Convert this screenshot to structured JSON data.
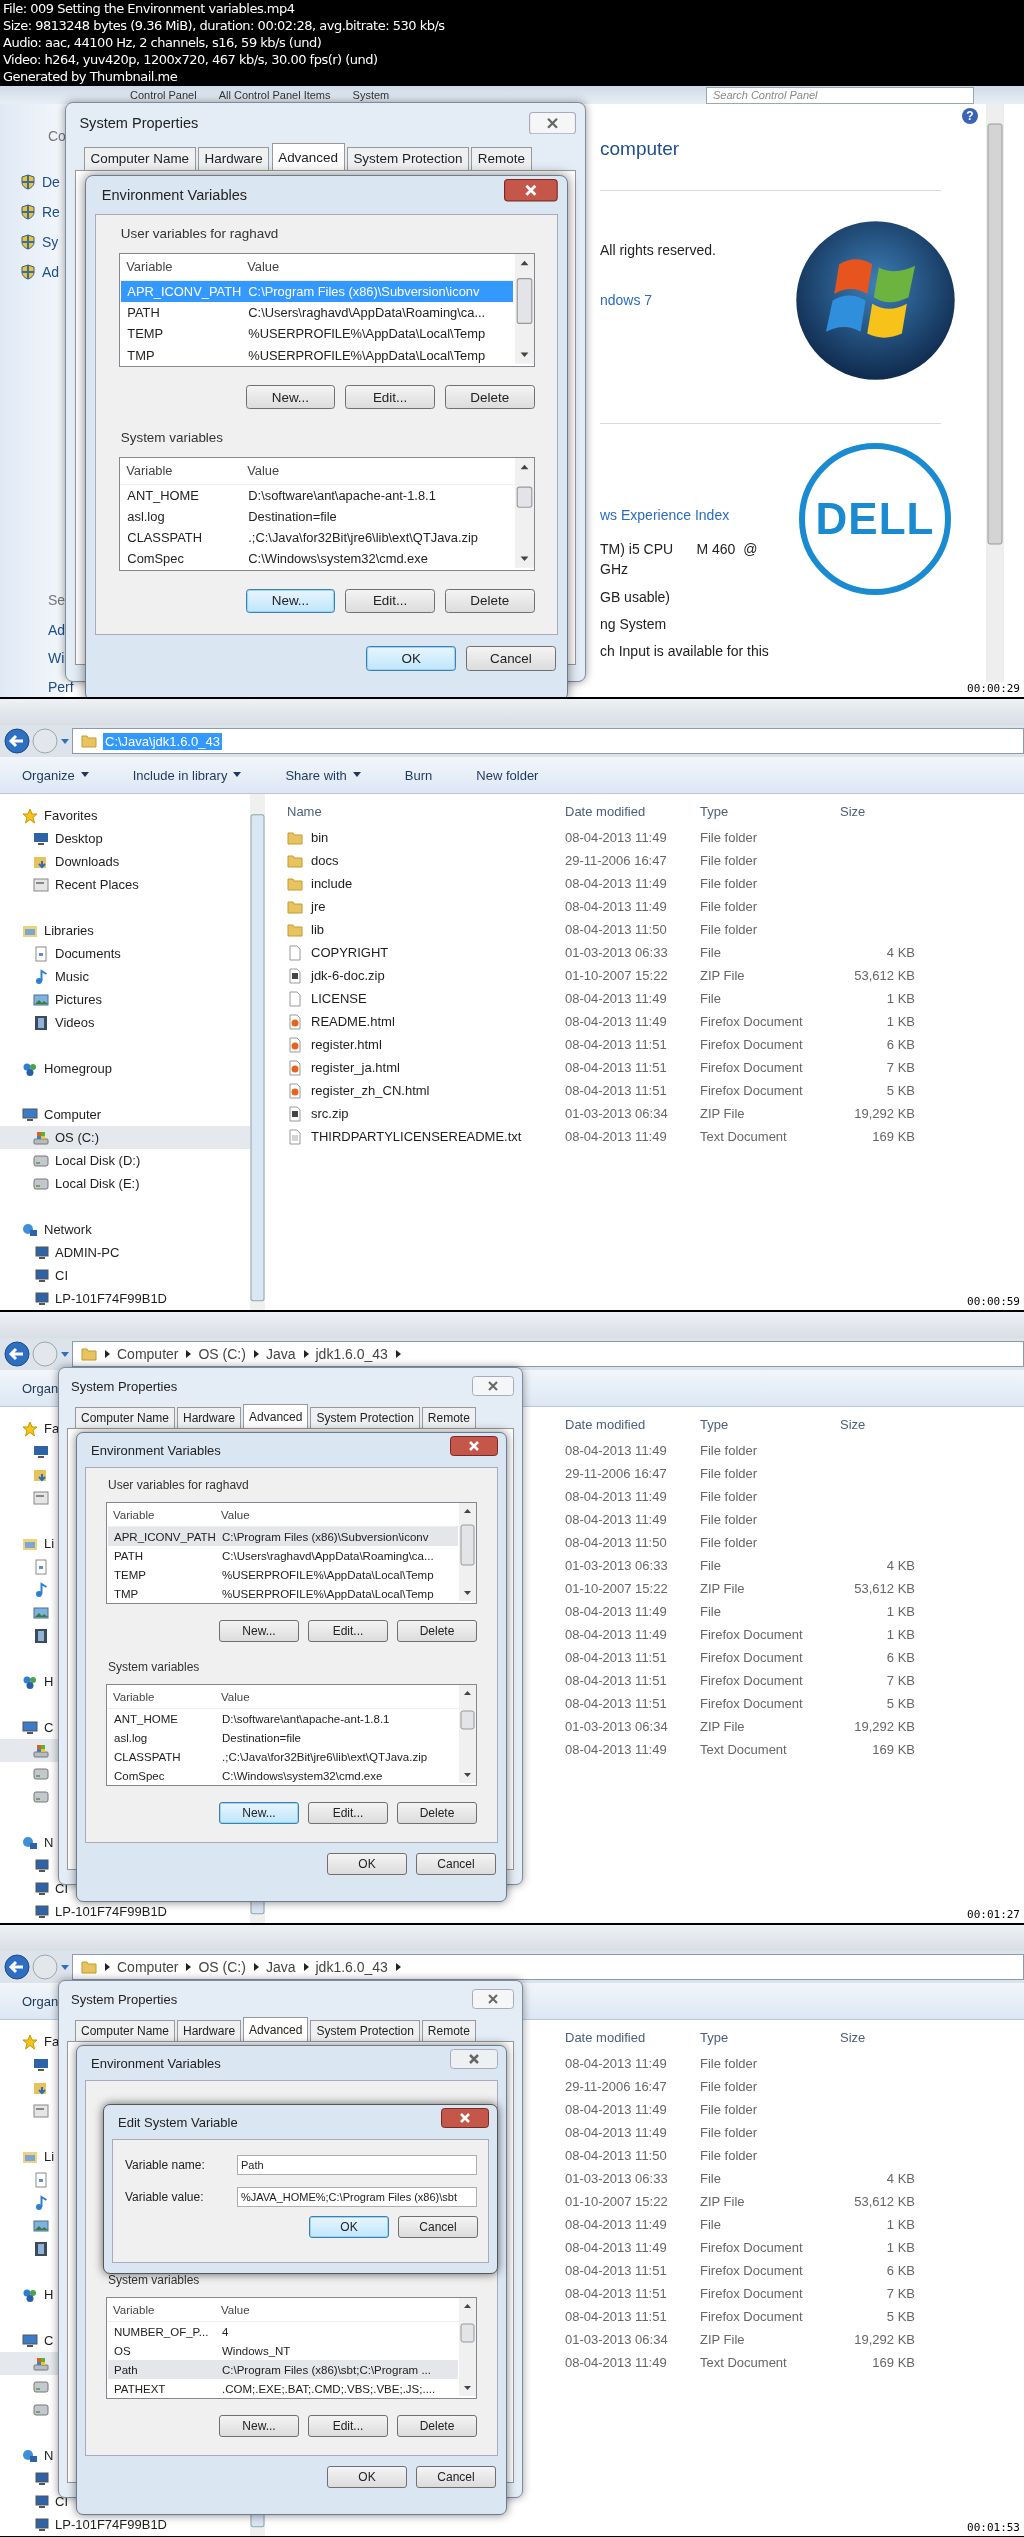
{
  "header": [
    "File: 009 Setting the Environment variables.mp4",
    "Size: 9813248 bytes (9.36 MiB), duration: 00:02:28, avg.bitrate: 530 kb/s",
    "Audio: aac, 44100 Hz, 2 channels, s16, 59 kb/s (und)",
    "Video: h264, yuv420p, 1200x720, 467 kb/s, 30.00 fps(r) (und)",
    "Generated by Thumbnail.me"
  ],
  "frames": [
    {
      "kind": "control_panel",
      "timestamp": "00:00:29",
      "breadcrumb": [
        "Control Panel",
        "All Control Panel Items",
        "System"
      ],
      "search": {
        "placeholder": "Search Control Panel"
      },
      "help_icon": "?",
      "nav": [
        {
          "label": "Co",
          "kind": "heading"
        },
        {
          "label": "De",
          "kind": "shield"
        },
        {
          "label": "Re",
          "kind": "shield"
        },
        {
          "label": "Sy",
          "kind": "shield"
        },
        {
          "label": "Ad",
          "kind": "shield"
        },
        {
          "label": "Se",
          "kind": "heading"
        },
        {
          "label": "Ad",
          "kind": "link"
        },
        {
          "label": "Wi",
          "kind": "link"
        },
        {
          "label": "Perf",
          "kind": "link"
        }
      ],
      "content": [
        {
          "text": "computer",
          "kind": "heading"
        },
        {
          "text": "All rights reserved.",
          "kind": "text"
        },
        {
          "text": "ndows 7",
          "kind": "link"
        },
        {
          "text": "ws Experience Index",
          "kind": "link"
        },
        {
          "text": "TM) i5 CPU      M 460  @",
          "kind": "text"
        },
        {
          "text": "GHz",
          "kind": "text"
        },
        {
          "text": "GB usable)",
          "kind": "text"
        },
        {
          "text": "ng System",
          "kind": "text"
        },
        {
          "text": "ch Input is available for this",
          "kind": "text"
        }
      ],
      "logo_text": "DELL",
      "dialog": {
        "title": "System Properties",
        "tabs": [
          {
            "label": "Computer Name",
            "selected": false
          },
          {
            "label": "Hardware",
            "selected": false
          },
          {
            "label": "Advanced",
            "selected": true
          },
          {
            "label": "System Protection",
            "selected": false
          },
          {
            "label": "Remote",
            "selected": false
          }
        ],
        "env": {
          "title": "Environment Variables",
          "active": true,
          "sections": [
            {
              "kind": "user",
              "label": "User variables for raghavd",
              "columns": [
                "Variable",
                "Value"
              ],
              "focused": true,
              "rows": [
                {
                  "variable": "APR_ICONV_PATH",
                  "value": "C:\\Program Files (x86)\\Subversion\\iconv",
                  "selected": true
                },
                {
                  "variable": "PATH",
                  "value": "C:\\Users\\raghavd\\AppData\\Roaming\\ca...",
                  "selected": false
                },
                {
                  "variable": "TEMP",
                  "value": "%USERPROFILE%\\AppData\\Local\\Temp",
                  "selected": false
                },
                {
                  "variable": "TMP",
                  "value": "%USERPROFILE%\\AppData\\Local\\Temp",
                  "selected": false
                }
              ],
              "buttons": [
                {
                  "label": "New...",
                  "focused": false
                },
                {
                  "label": "Edit...",
                  "focused": false
                },
                {
                  "label": "Delete",
                  "focused": false
                }
              ]
            },
            {
              "kind": "system",
              "label": "System variables",
              "columns": [
                "Variable",
                "Value"
              ],
              "focused": false,
              "rows": [
                {
                  "variable": "ANT_HOME",
                  "value": "D:\\software\\ant\\apache-ant-1.8.1",
                  "selected": false
                },
                {
                  "variable": "asl.log",
                  "value": "Destination=file",
                  "selected": false
                },
                {
                  "variable": "CLASSPATH",
                  "value": ".;C:\\Java\\for32Bit\\jre6\\lib\\ext\\QTJava.zip",
                  "selected": false
                },
                {
                  "variable": "ComSpec",
                  "value": "C:\\Windows\\system32\\cmd.exe",
                  "selected": false
                }
              ],
              "buttons": [
                {
                  "label": "New...",
                  "focused": true
                },
                {
                  "label": "Edit...",
                  "focused": false
                },
                {
                  "label": "Delete",
                  "focused": false
                }
              ]
            }
          ],
          "buttons": [
            {
              "label": "OK",
              "focused": true
            },
            {
              "label": "Cancel",
              "focused": false
            }
          ]
        }
      }
    },
    {
      "kind": "explorer",
      "timestamp": "00:00:59",
      "address": {
        "kind": "path",
        "text": "C:\\Java\\jdk1.6.0_43",
        "selected": true
      },
      "toolbar": [
        {
          "label": "Organize",
          "dropdown": true
        },
        {
          "label": "Include in library",
          "dropdown": true
        },
        {
          "label": "Share with",
          "dropdown": true
        },
        {
          "label": "Burn",
          "dropdown": false
        },
        {
          "label": "New folder",
          "dropdown": false
        }
      ],
      "sidebar": [
        {
          "label": "Favorites",
          "kind": "star",
          "selected": false,
          "children": [
            {
              "label": "Desktop",
              "kind": "desktop",
              "selected": false
            },
            {
              "label": "Downloads",
              "kind": "downloads",
              "selected": false
            },
            {
              "label": "Recent Places",
              "kind": "recent",
              "selected": false
            }
          ]
        },
        {
          "label": "Libraries",
          "kind": "library",
          "selected": false,
          "children": [
            {
              "label": "Documents",
              "kind": "documents",
              "selected": false
            },
            {
              "label": "Music",
              "kind": "music",
              "selected": false
            },
            {
              "label": "Pictures",
              "kind": "pictures",
              "selected": false
            },
            {
              "label": "Videos",
              "kind": "videos",
              "selected": false
            }
          ]
        },
        {
          "label": "Homegroup",
          "kind": "homegroup",
          "selected": false
        },
        {
          "label": "Computer",
          "kind": "computer",
          "selected": false,
          "children": [
            {
              "label": "OS (C:)",
              "kind": "os_drive",
              "selected": true
            },
            {
              "label": "Local Disk (D:)",
              "kind": "drive",
              "selected": false
            },
            {
              "label": "Local Disk (E:)",
              "kind": "drive",
              "selected": false
            }
          ]
        },
        {
          "label": "Network",
          "kind": "network",
          "selected": false,
          "children": [
            {
              "label": "ADMIN-PC",
              "kind": "pc",
              "selected": false
            },
            {
              "label": "CI",
              "kind": "pc",
              "selected": false
            },
            {
              "label": "LP-101F74F99B1D",
              "kind": "pc",
              "selected": false
            }
          ]
        }
      ],
      "columns": [
        "Name",
        "Date modified",
        "Type",
        "Size"
      ],
      "files": [
        {
          "name": "bin",
          "kind": "folder",
          "date": "08-04-2013 11:49",
          "type": "File folder"
        },
        {
          "name": "docs",
          "kind": "folder",
          "date": "29-11-2006 16:47",
          "type": "File folder"
        },
        {
          "name": "include",
          "kind": "folder",
          "date": "08-04-2013 11:49",
          "type": "File folder"
        },
        {
          "name": "jre",
          "kind": "folder",
          "date": "08-04-2013 11:49",
          "type": "File folder"
        },
        {
          "name": "lib",
          "kind": "folder",
          "date": "08-04-2013 11:50",
          "type": "File folder"
        },
        {
          "name": "COPYRIGHT",
          "kind": "file",
          "date": "01-03-2013 06:33",
          "type": "File",
          "size": "4 KB"
        },
        {
          "name": "jdk-6-doc.zip",
          "kind": "zip",
          "date": "01-10-2007 15:22",
          "type": "ZIP File",
          "size": "53,612 KB"
        },
        {
          "name": "LICENSE",
          "kind": "file",
          "date": "08-04-2013 11:49",
          "type": "File",
          "size": "1 KB"
        },
        {
          "name": "README.html",
          "kind": "html",
          "date": "08-04-2013 11:49",
          "type": "Firefox Document",
          "size": "1 KB"
        },
        {
          "name": "register.html",
          "kind": "html",
          "date": "08-04-2013 11:51",
          "type": "Firefox Document",
          "size": "6 KB"
        },
        {
          "name": "register_ja.html",
          "kind": "html",
          "date": "08-04-2013 11:51",
          "type": "Firefox Document",
          "size": "7 KB"
        },
        {
          "name": "register_zh_CN.html",
          "kind": "html",
          "date": "08-04-2013 11:51",
          "type": "Firefox Document",
          "size": "5 KB"
        },
        {
          "name": "src.zip",
          "kind": "zip",
          "date": "01-03-2013 06:34",
          "type": "ZIP File",
          "size": "19,292 KB"
        },
        {
          "name": "THIRDPARTYLICENSEREADME.txt",
          "kind": "txt",
          "date": "08-04-2013 11:49",
          "type": "Text Document",
          "size": "169 KB"
        }
      ]
    },
    {
      "kind": "explorer",
      "timestamp": "00:01:27",
      "address": {
        "kind": "breadcrumb",
        "items": [
          "Computer",
          "OS (C:)",
          "Java",
          "jdk1.6.0_43"
        ]
      },
      "toolbar": [
        {
          "label": "Organ",
          "dropdown": false
        }
      ],
      "sidebar": [
        {
          "label": "Fa",
          "kind": "star",
          "selected": false,
          "children": [
            {
              "kind": "desktop",
              "selected": false
            },
            {
              "kind": "downloads",
              "selected": false
            },
            {
              "kind": "recent",
              "selected": false
            }
          ]
        },
        {
          "label": "Li",
          "kind": "library",
          "selected": false,
          "children": [
            {
              "kind": "documents",
              "selected": false
            },
            {
              "kind": "music",
              "selected": false
            },
            {
              "kind": "pictures",
              "selected": false
            },
            {
              "kind": "videos",
              "selected": false
            }
          ]
        },
        {
          "label": "H",
          "kind": "homegroup",
          "selected": false
        },
        {
          "label": "C",
          "kind": "computer",
          "selected": false,
          "children": [
            {
              "kind": "os_drive",
              "selected": true
            },
            {
              "kind": "drive",
              "selected": false
            },
            {
              "kind": "drive",
              "selected": false
            }
          ]
        },
        {
          "label": "N",
          "kind": "network",
          "selected": false,
          "children": [
            {
              "kind": "pc",
              "selected": false
            },
            {
              "label": "CI",
              "kind": "pc",
              "selected": false
            },
            {
              "label": "LP-101F74F99B1D",
              "kind": "pc",
              "selected": false
            }
          ]
        }
      ],
      "columns": [
        "Date modified",
        "Type",
        "Size"
      ],
      "files": [
        {
          "date": "08-04-2013 11:49",
          "type": "File folder"
        },
        {
          "date": "29-11-2006 16:47",
          "type": "File folder"
        },
        {
          "date": "08-04-2013 11:49",
          "type": "File folder"
        },
        {
          "date": "08-04-2013 11:49",
          "type": "File folder"
        },
        {
          "date": "08-04-2013 11:50",
          "type": "File folder"
        },
        {
          "date": "01-03-2013 06:33",
          "type": "File",
          "size": "4 KB"
        },
        {
          "date": "01-10-2007 15:22",
          "type": "ZIP File",
          "size": "53,612 KB"
        },
        {
          "date": "08-04-2013 11:49",
          "type": "File",
          "size": "1 KB"
        },
        {
          "date": "08-04-2013 11:49",
          "type": "Firefox Document",
          "size": "1 KB"
        },
        {
          "date": "08-04-2013 11:51",
          "type": "Firefox Document",
          "size": "6 KB"
        },
        {
          "date": "08-04-2013 11:51",
          "type": "Firefox Document",
          "size": "7 KB"
        },
        {
          "date": "08-04-2013 11:51",
          "type": "Firefox Document",
          "size": "5 KB"
        },
        {
          "date": "01-03-2013 06:34",
          "type": "ZIP File",
          "size": "19,292 KB"
        },
        {
          "date": "08-04-2013 11:49",
          "type": "Text Document",
          "size": "169 KB"
        }
      ],
      "dialog": {
        "title": "System Properties",
        "tabs": [
          {
            "label": "Computer Name",
            "selected": false
          },
          {
            "label": "Hardware",
            "selected": false
          },
          {
            "label": "Advanced",
            "selected": true
          },
          {
            "label": "System Protection",
            "selected": false
          },
          {
            "label": "Remote",
            "selected": false
          }
        ],
        "env": {
          "title": "Environment Variables",
          "active": true,
          "sections": [
            {
              "kind": "user",
              "label": "User variables for raghavd",
              "columns": [
                "Variable",
                "Value"
              ],
              "focused": false,
              "rows": [
                {
                  "variable": "APR_ICONV_PATH",
                  "value": "C:\\Program Files (x86)\\Subversion\\iconv",
                  "selected": true
                },
                {
                  "variable": "PATH",
                  "value": "C:\\Users\\raghavd\\AppData\\Roaming\\ca...",
                  "selected": false
                },
                {
                  "variable": "TEMP",
                  "value": "%USERPROFILE%\\AppData\\Local\\Temp",
                  "selected": false
                },
                {
                  "variable": "TMP",
                  "value": "%USERPROFILE%\\AppData\\Local\\Temp",
                  "selected": false
                }
              ],
              "buttons": [
                {
                  "label": "New...",
                  "focused": false
                },
                {
                  "label": "Edit...",
                  "focused": false
                },
                {
                  "label": "Delete",
                  "focused": false
                }
              ]
            },
            {
              "kind": "system",
              "label": "System variables",
              "columns": [
                "Variable",
                "Value"
              ],
              "focused": false,
              "rows": [
                {
                  "variable": "ANT_HOME",
                  "value": "D:\\software\\ant\\apache-ant-1.8.1",
                  "selected": false
                },
                {
                  "variable": "asl.log",
                  "value": "Destination=file",
                  "selected": false
                },
                {
                  "variable": "CLASSPATH",
                  "value": ".;C:\\Java\\for32Bit\\jre6\\lib\\ext\\QTJava.zip",
                  "selected": false
                },
                {
                  "variable": "ComSpec",
                  "value": "C:\\Windows\\system32\\cmd.exe",
                  "selected": false
                }
              ],
              "buttons": [
                {
                  "label": "New...",
                  "focused": true
                },
                {
                  "label": "Edit...",
                  "focused": false
                },
                {
                  "label": "Delete",
                  "focused": false
                }
              ]
            }
          ],
          "buttons": [
            {
              "label": "OK",
              "focused": false
            },
            {
              "label": "Cancel",
              "focused": false
            }
          ]
        }
      }
    },
    {
      "kind": "explorer",
      "timestamp": "00:01:53",
      "address": {
        "kind": "breadcrumb",
        "items": [
          "Computer",
          "OS (C:)",
          "Java",
          "jdk1.6.0_43"
        ]
      },
      "toolbar": [
        {
          "label": "Organ",
          "dropdown": false
        }
      ],
      "sidebar": [
        {
          "label": "Fa",
          "kind": "star",
          "selected": false,
          "children": [
            {
              "kind": "desktop",
              "selected": false
            },
            {
              "kind": "downloads",
              "selected": false
            },
            {
              "kind": "recent",
              "selected": false
            }
          ]
        },
        {
          "label": "Li",
          "kind": "library",
          "selected": false,
          "children": [
            {
              "kind": "documents",
              "selected": false
            },
            {
              "kind": "music",
              "selected": false
            },
            {
              "kind": "pictures",
              "selected": false
            },
            {
              "kind": "videos",
              "selected": false
            }
          ]
        },
        {
          "label": "H",
          "kind": "homegroup",
          "selected": false
        },
        {
          "label": "C",
          "kind": "computer",
          "selected": false,
          "children": [
            {
              "kind": "os_drive",
              "selected": true
            },
            {
              "kind": "drive",
              "selected": false
            },
            {
              "kind": "drive",
              "selected": false
            }
          ]
        },
        {
          "label": "N",
          "kind": "network",
          "selected": false,
          "children": [
            {
              "kind": "pc",
              "selected": false
            },
            {
              "label": "CI",
              "kind": "pc",
              "selected": false
            },
            {
              "label": "LP-101F74F99B1D",
              "kind": "pc",
              "selected": false
            }
          ]
        }
      ],
      "columns": [
        "Date modified",
        "Type",
        "Size"
      ],
      "files": [
        {
          "date": "08-04-2013 11:49",
          "type": "File folder"
        },
        {
          "date": "29-11-2006 16:47",
          "type": "File folder"
        },
        {
          "date": "08-04-2013 11:49",
          "type": "File folder"
        },
        {
          "date": "08-04-2013 11:49",
          "type": "File folder"
        },
        {
          "date": "08-04-2013 11:50",
          "type": "File folder"
        },
        {
          "date": "01-03-2013 06:33",
          "type": "File",
          "size": "4 KB"
        },
        {
          "date": "01-10-2007 15:22",
          "type": "ZIP File",
          "size": "53,612 KB"
        },
        {
          "date": "08-04-2013 11:49",
          "type": "File",
          "size": "1 KB"
        },
        {
          "date": "08-04-2013 11:49",
          "type": "Firefox Document",
          "size": "1 KB"
        },
        {
          "date": "08-04-2013 11:51",
          "type": "Firefox Document",
          "size": "6 KB"
        },
        {
          "date": "08-04-2013 11:51",
          "type": "Firefox Document",
          "size": "7 KB"
        },
        {
          "date": "08-04-2013 11:51",
          "type": "Firefox Document",
          "size": "5 KB"
        },
        {
          "date": "01-03-2013 06:34",
          "type": "ZIP File",
          "size": "19,292 KB"
        },
        {
          "date": "08-04-2013 11:49",
          "type": "Text Document",
          "size": "169 KB"
        }
      ],
      "dialog": {
        "title": "System Properties",
        "tabs": [
          {
            "label": "Computer Name",
            "selected": false
          },
          {
            "label": "Hardware",
            "selected": false
          },
          {
            "label": "Advanced",
            "selected": true
          },
          {
            "label": "System Protection",
            "selected": false
          },
          {
            "label": "Remote",
            "selected": false
          }
        ],
        "env": {
          "title": "Environment Variables",
          "active": false,
          "sections": [
            {
              "kind": "system",
              "label": "System variables",
              "columns": [
                "Variable",
                "Value"
              ],
              "focused": false,
              "rows": [
                {
                  "variable": "NUMBER_OF_P...",
                  "value": "4",
                  "selected": false
                },
                {
                  "variable": "OS",
                  "value": "Windows_NT",
                  "selected": false
                },
                {
                  "variable": "Path",
                  "value": "C:\\Program Files (x86)\\sbt;C:\\Program ...",
                  "selected": true
                },
                {
                  "variable": "PATHEXT",
                  "value": ".COM;.EXE;.BAT;.CMD;.VBS;.VBE;.JS;....",
                  "selected": false
                }
              ],
              "buttons": [
                {
                  "label": "New...",
                  "focused": false
                },
                {
                  "label": "Edit...",
                  "focused": false
                },
                {
                  "label": "Delete",
                  "focused": false
                }
              ]
            }
          ],
          "buttons": [
            {
              "label": "OK",
              "focused": false
            },
            {
              "label": "Cancel",
              "focused": false
            }
          ],
          "edit": {
            "title": "Edit System Variable",
            "active": true,
            "fields": [
              {
                "label": "Variable name:",
                "value": "Path"
              },
              {
                "label": "Variable value:",
                "value": "%JAVA_HOME%;C:\\Program Files (x86)\\sbt"
              }
            ],
            "buttons": [
              {
                "label": "OK",
                "focused": true
              },
              {
                "label": "Cancel",
                "focused": false
              }
            ]
          }
        }
      }
    }
  ]
}
